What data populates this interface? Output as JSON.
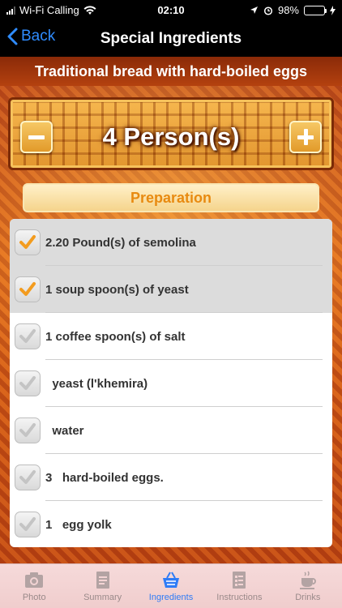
{
  "status": {
    "carrier": "Wi-Fi Calling",
    "time": "02:10",
    "battery": "98%",
    "battery_level": 0.98
  },
  "nav": {
    "back_label": "Back",
    "title": "Special Ingredients"
  },
  "recipe": {
    "title": "Traditional bread with hard-boiled eggs"
  },
  "servings": {
    "label": "4 Person(s)"
  },
  "section_tab": {
    "label": "Preparation"
  },
  "ingredients": [
    {
      "text": "2.20 Pound(s) of semolina",
      "checked": true
    },
    {
      "text": "1 soup spoon(s) of yeast",
      "checked": true
    },
    {
      "text": "1 coffee spoon(s) of salt",
      "checked": false
    },
    {
      "text": "  yeast (l'khemira)",
      "checked": false
    },
    {
      "text": "  water",
      "checked": false
    },
    {
      "text": "3   hard-boiled eggs.",
      "checked": false
    },
    {
      "text": "1   egg yolk",
      "checked": false
    }
  ],
  "tabs": [
    {
      "label": "Photo",
      "icon": "camera-icon",
      "active": false
    },
    {
      "label": "Summary",
      "icon": "notepad-icon",
      "active": false
    },
    {
      "label": "Ingredients",
      "icon": "basket-icon",
      "active": true
    },
    {
      "label": "Instructions",
      "icon": "checklist-icon",
      "active": false
    },
    {
      "label": "Drinks",
      "icon": "cup-icon",
      "active": false
    }
  ],
  "colors": {
    "accent": "#2f7cf6",
    "check_active": "#f39c1f",
    "check_inactive": "#c4c4c4",
    "battery": "#4cd964"
  }
}
